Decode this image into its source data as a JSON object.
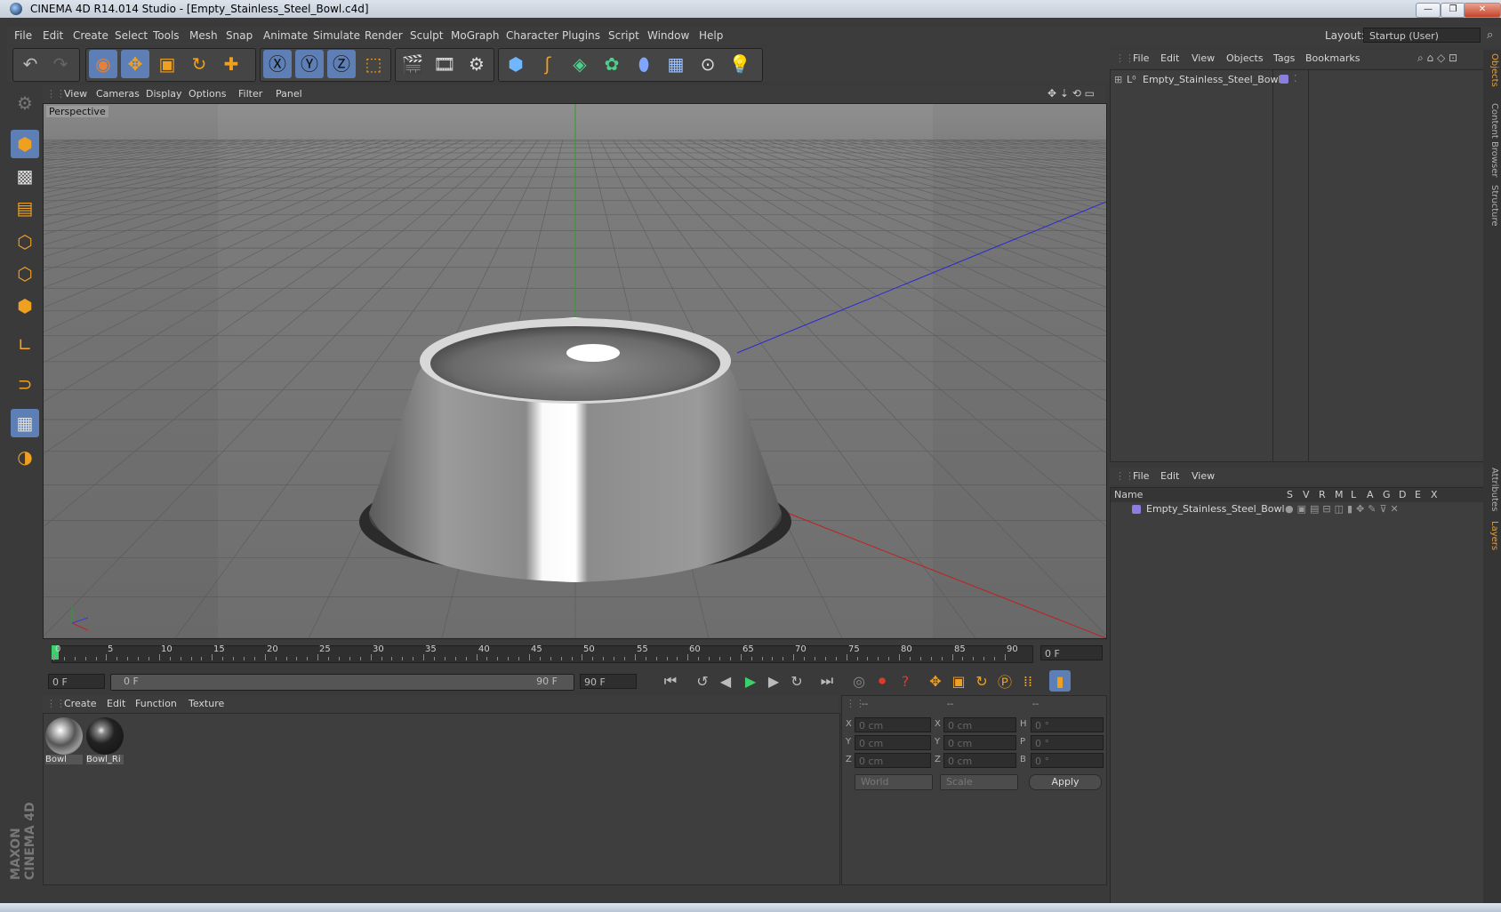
{
  "window": {
    "title": "CINEMA 4D R14.014 Studio - [Empty_Stainless_Steel_Bowl.c4d]",
    "minimize": "—",
    "restore": "❐",
    "close": "✕"
  },
  "menubar": {
    "items": [
      "File",
      "Edit",
      "Create",
      "Select",
      "Tools",
      "Mesh",
      "Snap",
      "Animate",
      "Simulate",
      "Render",
      "Sculpt",
      "MoGraph",
      "Character",
      "Plugins",
      "Script",
      "Window",
      "Help"
    ],
    "layout_label": "Layout:",
    "layout_value": "Startup (User)"
  },
  "viewport": {
    "menu": [
      "View",
      "Cameras",
      "Display",
      "Options",
      "Filter",
      "Panel"
    ],
    "label": "Perspective"
  },
  "timeline": {
    "ticks": [
      "0",
      "5",
      "10",
      "15",
      "20",
      "25",
      "30",
      "35",
      "40",
      "45",
      "50",
      "55",
      "60",
      "65",
      "70",
      "75",
      "80",
      "85",
      "90"
    ],
    "current_frame": "0 F",
    "start_field": "0 F",
    "range_start": "0 F",
    "range_end": "90 F",
    "end_field": "90 F"
  },
  "material_manager": {
    "menu": [
      "Create",
      "Edit",
      "Function",
      "Texture"
    ],
    "materials": [
      {
        "name": "Bowl"
      },
      {
        "name": "Bowl_Ri"
      }
    ]
  },
  "coordinates": {
    "headers": [
      "--",
      "--",
      "--"
    ],
    "rows": [
      {
        "p_label": "X",
        "p_value": "0 cm",
        "s_label": "X",
        "s_value": "0 cm",
        "r_label": "H",
        "r_value": "0 °"
      },
      {
        "p_label": "Y",
        "p_value": "0 cm",
        "s_label": "Y",
        "s_value": "0 cm",
        "r_label": "P",
        "r_value": "0 °"
      },
      {
        "p_label": "Z",
        "p_value": "0 cm",
        "s_label": "Z",
        "s_value": "0 cm",
        "r_label": "B",
        "r_value": "0 °"
      }
    ],
    "space_select": "World",
    "mode_select": "Scale",
    "apply_label": "Apply"
  },
  "object_manager": {
    "menu": [
      "File",
      "Edit",
      "View",
      "Objects",
      "Tags",
      "Bookmarks"
    ],
    "object_name": "Empty_Stainless_Steel_Bowl"
  },
  "layer_manager": {
    "menu": [
      "File",
      "Edit",
      "View"
    ],
    "columns": [
      "Name",
      "S",
      "V",
      "R",
      "M",
      "L",
      "A",
      "G",
      "D",
      "E",
      "X"
    ],
    "layer_name": "Empty_Stainless_Steel_Bowl"
  },
  "side_tabs": [
    "Objects",
    "Content Browser",
    "Structure",
    "Attributes",
    "Layers"
  ],
  "branding": "MAXON CINEMA 4D",
  "colors": {
    "accent": "#5d7fb5",
    "layer_swatch": "#8a7fe0"
  }
}
